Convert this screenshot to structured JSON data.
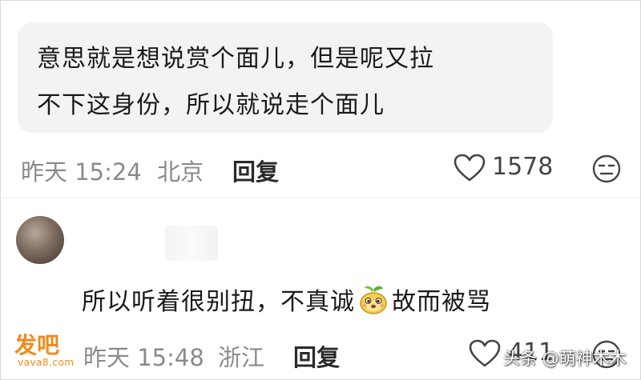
{
  "comment1": {
    "text_line1": "意思就是想说赏个面儿，但是呢又拉",
    "text_line2": "不下这身份，所以就说走个面儿",
    "time": "昨天 15:24",
    "location": "北京",
    "reply_label": "回复",
    "likes": "1578",
    "icons": [
      "heart-outline-icon",
      "neutral-face-icon"
    ]
  },
  "comment2": {
    "text_before_emoji": "所以听着很别扭，不真诚",
    "emoji": "sprout-creature-emoji",
    "text_after_emoji": "故而被骂",
    "time": "昨天 15:48",
    "location": "浙江",
    "reply_label": "回复",
    "likes": "411",
    "icons": [
      "heart-outline-icon",
      "neutral-face-icon"
    ]
  },
  "logo": {
    "main": "发吧",
    "sub": "vava8.com"
  },
  "watermark": "头条 @萌神木木",
  "colors": {
    "logo": "#f08a1c",
    "bubble": "#f3f3f3",
    "meta": "#8a8a8a"
  }
}
